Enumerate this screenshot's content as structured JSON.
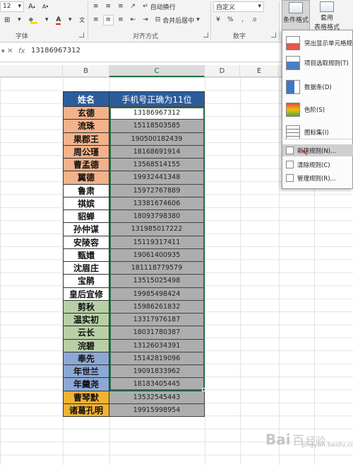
{
  "ribbon": {
    "font_size": "12",
    "grow_font": "A",
    "shrink_font": "A",
    "fill_color_glyph": "◆",
    "font_color_glyph": "A",
    "wrap_text": "自动换行",
    "merge_center": "合并后居中",
    "number_format": "自定义",
    "percent": "%",
    "comma": ",",
    "conditional_format": "条件格式",
    "format_as_table_line1": "套用",
    "format_as_table_line2": "表格格式",
    "group_font": "字体",
    "group_alignment": "对齐方式",
    "group_number": "数字"
  },
  "formula_bar": {
    "fx": "fx",
    "value": "13186967312"
  },
  "columns": [
    "B",
    "C",
    "D",
    "E"
  ],
  "table": {
    "header": {
      "name": "姓名",
      "phone": "手机号正确为11位"
    },
    "rows": [
      {
        "name": "玄德",
        "phone": "13186967312",
        "color": "#f4b28a"
      },
      {
        "name": "流珠",
        "phone": "15118503585",
        "color": "#f4b28a"
      },
      {
        "name": "果郡王",
        "phone": "190500182439",
        "color": "#f4b28a"
      },
      {
        "name": "周公瑾",
        "phone": "18168691914",
        "color": "#f4b28a"
      },
      {
        "name": "曹孟德",
        "phone": "13568514155",
        "color": "#f4b28a"
      },
      {
        "name": "翼德",
        "phone": "19932441348",
        "color": "#f4b28a"
      },
      {
        "name": "鲁肃",
        "phone": "15972767889",
        "color": "#ffffff"
      },
      {
        "name": "祺嫔",
        "phone": "13381674606",
        "color": "#ffffff"
      },
      {
        "name": "貂蝉",
        "phone": "18093798380",
        "color": "#ffffff"
      },
      {
        "name": "孙仲谋",
        "phone": "131985017222",
        "color": "#ffffff"
      },
      {
        "name": "安陵容",
        "phone": "15119317411",
        "color": "#ffffff"
      },
      {
        "name": "甄嬛",
        "phone": "19061400935",
        "color": "#ffffff"
      },
      {
        "name": "沈眉庄",
        "phone": "181118779579",
        "color": "#ffffff"
      },
      {
        "name": "宝鹃",
        "phone": "13515025498",
        "color": "#ffffff"
      },
      {
        "name": "皇后宜修",
        "phone": "19985498424",
        "color": "#ffffff"
      },
      {
        "name": "剪秋",
        "phone": "15986261832",
        "color": "#b8cfa6"
      },
      {
        "name": "温实初",
        "phone": "13317976187",
        "color": "#b8cfa6"
      },
      {
        "name": "云长",
        "phone": "18031780387",
        "color": "#b8cfa6"
      },
      {
        "name": "浣碧",
        "phone": "13126034391",
        "color": "#b8cfa6"
      },
      {
        "name": "奉先",
        "phone": "15142819096",
        "color": "#8ba8d4"
      },
      {
        "name": "年世兰",
        "phone": "19091833962",
        "color": "#8ba8d4"
      },
      {
        "name": "年羹尧",
        "phone": "18183405445",
        "color": "#8ba8d4"
      },
      {
        "name": "曹琴默",
        "phone": "13532545443",
        "color": "#f0b232"
      },
      {
        "name": "诸葛孔明",
        "phone": "19915998954",
        "color": "#f0b232"
      }
    ]
  },
  "cf_menu": {
    "items": [
      {
        "label": "突出显示单元格规",
        "icon": "highlight-rules-icon"
      },
      {
        "label": "项目选取规则(T)",
        "icon": "top-bottom-rules-icon"
      },
      {
        "label": "数据条(D)",
        "icon": "data-bars-icon"
      },
      {
        "label": "色阶(S)",
        "icon": "color-scales-icon"
      },
      {
        "label": "图标集(I)",
        "icon": "icon-sets-icon"
      },
      {
        "label": "新建规则(N)...",
        "icon": "new-rule-icon"
      },
      {
        "label": "清除规则(C)",
        "icon": "clear-rules-icon"
      },
      {
        "label": "管理规则(R)...",
        "icon": "manage-rules-icon"
      }
    ]
  },
  "watermark": {
    "text": "Bai百经验",
    "sub": "jingyan.baidu.com"
  }
}
